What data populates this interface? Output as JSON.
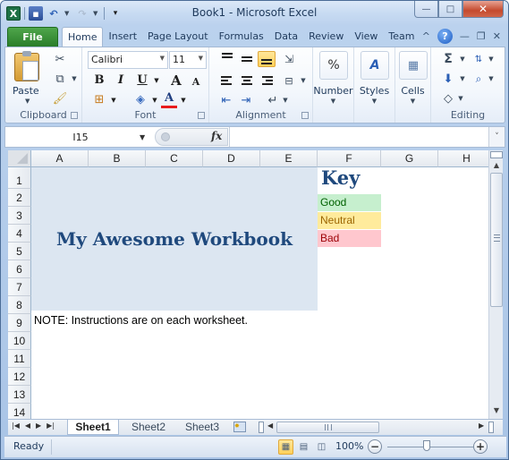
{
  "window": {
    "title": "Book1  -  Microsoft Excel",
    "app_icon": "excel-icon",
    "quick_access": [
      "save-icon",
      "undo-icon",
      "redo-icon",
      "customize-icon"
    ],
    "controls": {
      "minimize": "—",
      "maximize": "□",
      "close": "✕"
    }
  },
  "ribbon_tabs": {
    "file": "File",
    "tabs": [
      "Home",
      "Insert",
      "Page Layout",
      "Formulas",
      "Data",
      "Review",
      "View",
      "Team"
    ],
    "active": "Home",
    "right_icons": {
      "collapse": "^",
      "help": "?",
      "minimize": "—",
      "restore": "❐",
      "close": "✕"
    }
  },
  "ribbon": {
    "groups": {
      "clipboard": {
        "label": "Clipboard",
        "paste": "Paste"
      },
      "font": {
        "label": "Font",
        "font_name": "Calibri",
        "font_size": "11",
        "bold": "B",
        "italic": "I",
        "underline": "U",
        "grow": "A",
        "shrink": "A",
        "font_color": "A",
        "font_color_hex": "#e81c1c"
      },
      "alignment": {
        "label": "Alignment",
        "active_button": "middle-align"
      },
      "number": {
        "label": "Number",
        "icon": "%"
      },
      "styles": {
        "label": "Styles"
      },
      "cells": {
        "label": "Cells"
      },
      "editing": {
        "label": "Editing",
        "sum": "Σ"
      }
    }
  },
  "formula_bar": {
    "name_box": "I15",
    "fx": "fx",
    "formula": ""
  },
  "grid": {
    "columns": [
      "A",
      "B",
      "C",
      "D",
      "E",
      "F",
      "G",
      "H"
    ],
    "rows": [
      "1",
      "2",
      "3",
      "4",
      "5",
      "6",
      "7",
      "8",
      "9",
      "10",
      "11",
      "12",
      "13",
      "14"
    ],
    "title_cell": "My Awesome Workbook",
    "title_fill": "#dce6f1",
    "key": {
      "heading": "Key",
      "items": [
        {
          "label": "Good",
          "fill": "#c6efce",
          "text": "#006100"
        },
        {
          "label": "Neutral",
          "fill": "#ffeb9c",
          "text": "#9c6500"
        },
        {
          "label": "Bad",
          "fill": "#ffc7ce",
          "text": "#9c0006"
        }
      ]
    },
    "note": "NOTE: Instructions are on each worksheet."
  },
  "sheets": {
    "tabs": [
      "Sheet1",
      "Sheet2",
      "Sheet3"
    ],
    "active": "Sheet1"
  },
  "status": {
    "text": "Ready",
    "zoom": "100%",
    "zoom_minus": "−",
    "zoom_plus": "+"
  }
}
